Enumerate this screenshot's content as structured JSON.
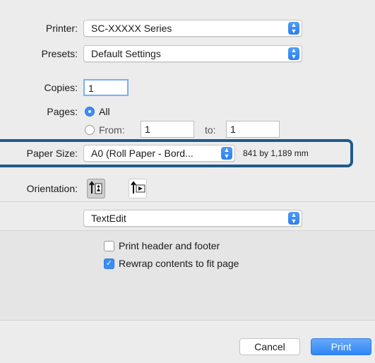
{
  "printer": {
    "label": "Printer:",
    "value": "SC-XXXXX Series"
  },
  "presets": {
    "label": "Presets:",
    "value": "Default Settings"
  },
  "copies": {
    "label": "Copies:",
    "value": "1"
  },
  "pages": {
    "label": "Pages:",
    "all_label": "All",
    "from_label": "From:",
    "from_value": "1",
    "to_label": "to:",
    "to_value": "1",
    "selected": "All"
  },
  "paper_size": {
    "label": "Paper Size:",
    "value": "A0 (Roll Paper - Bord...",
    "dimensions": "841 by 1,189 mm"
  },
  "orientation": {
    "label": "Orientation:",
    "selected": "portrait"
  },
  "section_popup": {
    "value": "TextEdit"
  },
  "options": {
    "header_footer": {
      "label": "Print header and footer",
      "checked": false
    },
    "rewrap": {
      "label": "Rewrap contents to fit page",
      "checked": true
    }
  },
  "buttons": {
    "cancel": "Cancel",
    "print": "Print"
  },
  "icons": {
    "stepper": "up-down-chevron-icon",
    "portrait": "portrait-orientation-icon",
    "landscape": "landscape-orientation-icon",
    "check": "checkmark-icon"
  },
  "colors": {
    "accent": "#3b8cf5",
    "highlight_frame": "#1f5a8c",
    "background": "#ececec"
  }
}
